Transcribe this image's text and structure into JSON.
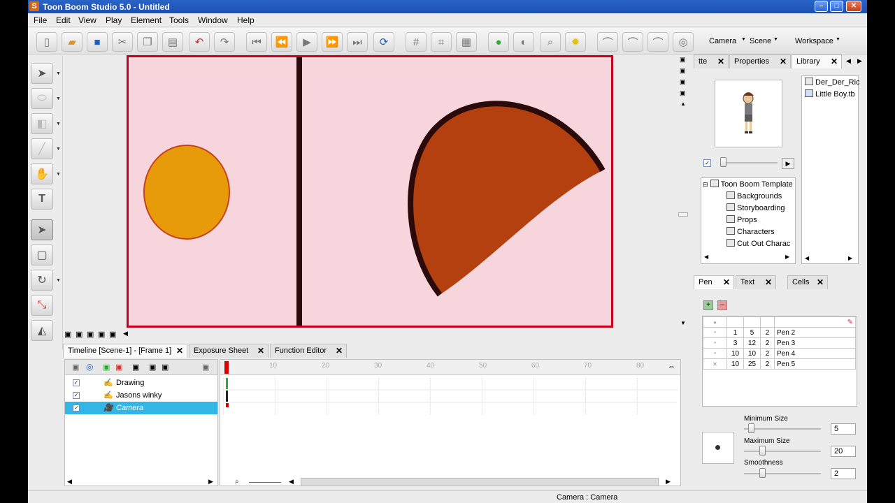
{
  "window": {
    "title": "Toon Boom Studio 5.0 - Untitled",
    "app_icon": "S"
  },
  "menu": [
    "File",
    "Edit",
    "View",
    "Play",
    "Element",
    "Tools",
    "Window",
    "Help"
  ],
  "toolbar": {
    "camera_label": "Camera",
    "scene_label": "Scene",
    "workspace_label": "Workspace"
  },
  "lower_tabs": [
    {
      "label": "Timeline [Scene-1] - [Frame 1]"
    },
    {
      "label": "Exposure Sheet"
    },
    {
      "label": "Function Editor"
    }
  ],
  "timeline": {
    "ruler_ticks": [
      "10",
      "20",
      "30",
      "40",
      "50",
      "60",
      "70",
      "80"
    ],
    "layers": [
      {
        "name": "Drawing",
        "checked": "✓"
      },
      {
        "name": "Jasons winky",
        "checked": "✓"
      },
      {
        "name": "Camera",
        "checked": "✓"
      }
    ]
  },
  "right_top_tabs": [
    {
      "label": "tte"
    },
    {
      "label": "Properties"
    },
    {
      "label": "Library"
    }
  ],
  "library": {
    "files": [
      "Der_Der_Ric",
      "Little Boy.tb"
    ],
    "tree": [
      "Toon Boom Template",
      "Backgrounds",
      "Storyboarding",
      "Props",
      "Characters",
      "Cut Out Charac"
    ]
  },
  "right_bottom_tabs": [
    {
      "label": "Pen"
    },
    {
      "label": "Text"
    },
    {
      "label": "Cells"
    }
  ],
  "pens": {
    "rows": [
      {
        "a": "1",
        "b": "5",
        "c": "2",
        "name": "Pen 2"
      },
      {
        "a": "3",
        "b": "12",
        "c": "2",
        "name": "Pen 3"
      },
      {
        "a": "10",
        "b": "10",
        "c": "2",
        "name": "Pen 4"
      },
      {
        "a": "10",
        "b": "25",
        "c": "2",
        "name": "Pen 5"
      }
    ],
    "min_size_label": "Minimum Size",
    "min_size_value": "5",
    "max_size_label": "Maximum Size",
    "max_size_value": "20",
    "smoothness_label": "Smoothness",
    "smoothness_value": "2"
  },
  "status": {
    "text": "Camera : Camera"
  },
  "colors": {
    "stage_bg": "#f7d5dc",
    "stage_border": "#c8001c",
    "circle_fill": "#e89b0a",
    "shape_fill": "#b5400f",
    "selected_layer": "#33b5e5"
  }
}
